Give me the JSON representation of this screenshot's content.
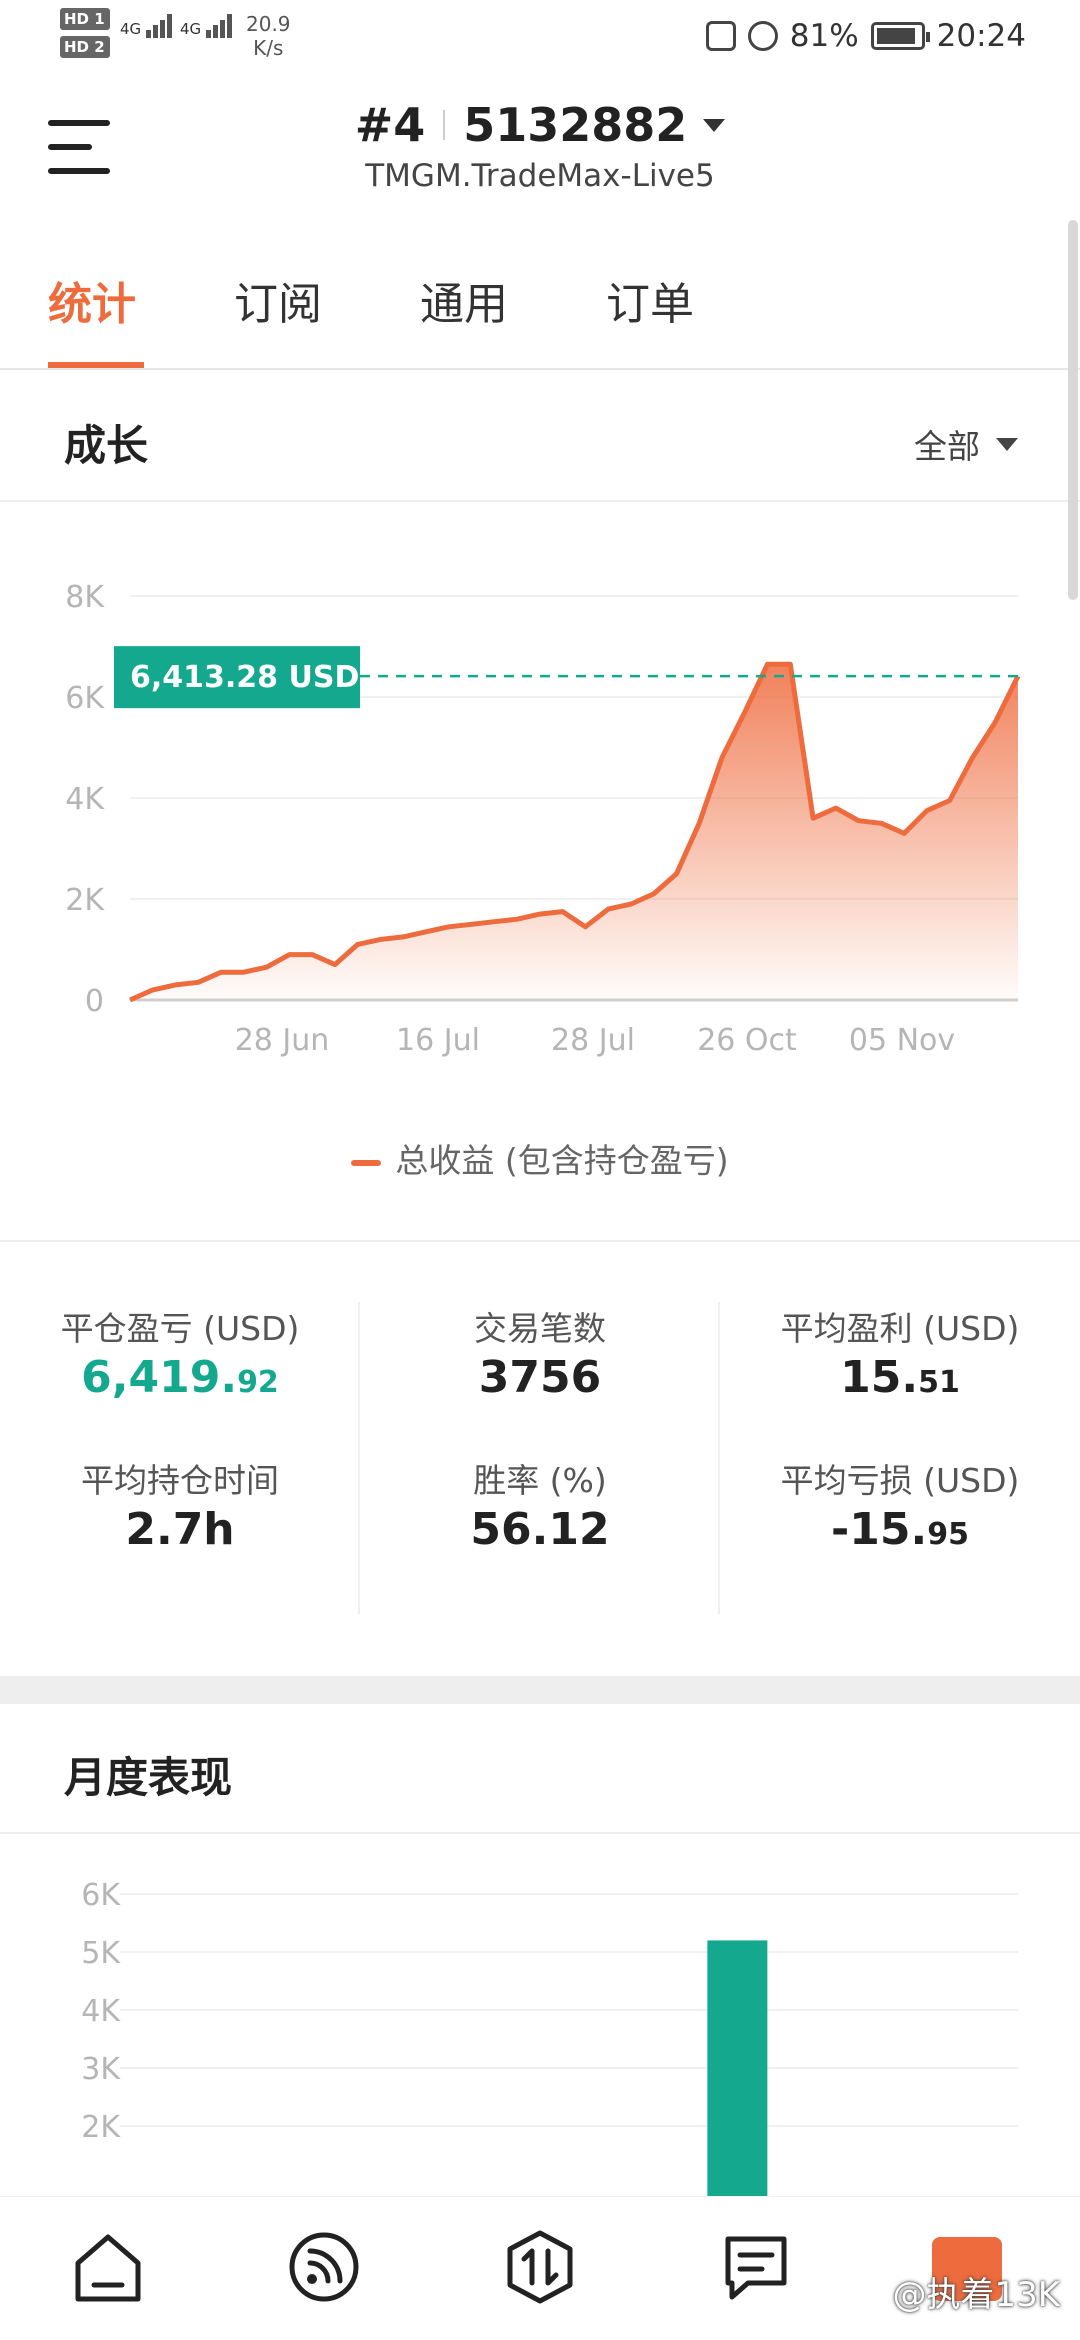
{
  "status": {
    "hd1": "HD 1",
    "hd2": "HD 2",
    "sig1": "4G",
    "sig2": "4G",
    "speed_value": "20.9",
    "speed_unit": "K/s",
    "battery": "81%",
    "time": "20:24"
  },
  "header": {
    "account_no": "#4",
    "account_id": "5132882",
    "server": "TMGM.TradeMax-Live5"
  },
  "tabs": [
    {
      "label": "统计",
      "active": true
    },
    {
      "label": "订阅",
      "active": false
    },
    {
      "label": "通用",
      "active": false
    },
    {
      "label": "订单",
      "active": false
    }
  ],
  "growth": {
    "title": "成长",
    "filter": "全部",
    "current_label": "6,413.28 USD",
    "legend": "总收益 (包含持仓盈亏)"
  },
  "stats": {
    "closed_pnl": {
      "label": "平仓盈亏 (USD)",
      "int": "6,419.",
      "dec": "92"
    },
    "trades": {
      "label": "交易笔数",
      "value": "3756"
    },
    "avg_profit": {
      "label": "平均盈利 (USD)",
      "int": "15.",
      "dec": "51"
    },
    "avg_hold": {
      "label": "平均持仓时间",
      "value": "2.7h"
    },
    "win_rate": {
      "label": "胜率 (%)",
      "value": "56.12"
    },
    "avg_loss": {
      "label": "平均亏损 (USD)",
      "int": "-15.",
      "dec": "95"
    }
  },
  "monthly": {
    "title": "月度表现"
  },
  "watermark": "@执着13K",
  "colors": {
    "accent": "#ee6b3d",
    "green": "#14a98f"
  },
  "chart_data": [
    {
      "type": "area",
      "x_ticks": [
        "28 Jun",
        "16 Jul",
        "28 Jul",
        "26 Oct",
        "05 Nov"
      ],
      "y_ticks": [
        "0",
        "2K",
        "4K",
        "6K",
        "8K"
      ],
      "ylim": [
        0,
        8000
      ],
      "series": [
        {
          "name": "总收益 (包含持仓盈亏)",
          "values": [
            0,
            200,
            300,
            350,
            550,
            550,
            650,
            900,
            900,
            700,
            1100,
            1200,
            1250,
            1350,
            1450,
            1500,
            1550,
            1600,
            1700,
            1750,
            1450,
            1800,
            1900,
            2100,
            2500,
            3500,
            4800,
            5700,
            6650,
            6650,
            3600,
            3800,
            3550,
            3500,
            3300,
            3750,
            3950,
            4800,
            5500,
            6413
          ]
        }
      ],
      "annotation": "6,413.28 USD",
      "grid": true
    },
    {
      "type": "bar",
      "y_ticks": [
        "2K",
        "3K",
        "4K",
        "5K",
        "6K"
      ],
      "ylim": [
        0,
        6000
      ],
      "categories_count": 8,
      "values": [
        null,
        null,
        null,
        null,
        null,
        5200,
        null,
        null
      ],
      "grid": true
    }
  ]
}
